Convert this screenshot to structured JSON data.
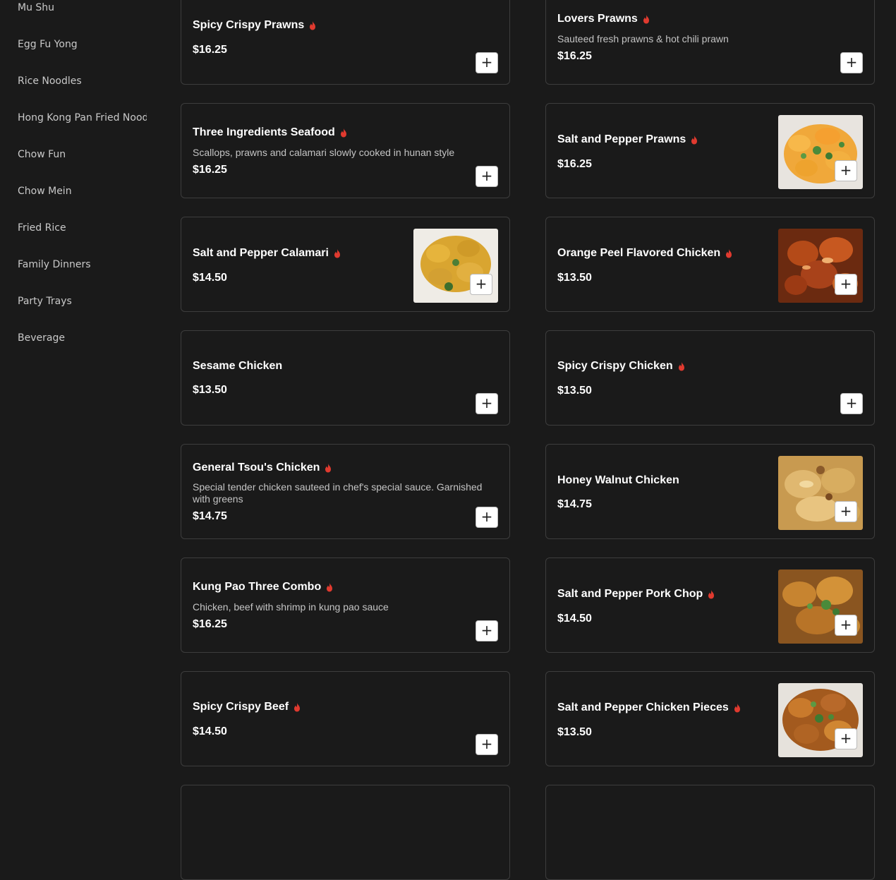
{
  "sidebar": {
    "items": [
      {
        "label": "Mu Shu"
      },
      {
        "label": "Egg Fu Yong"
      },
      {
        "label": "Rice Noodles"
      },
      {
        "label": "Hong Kong Pan Fried Noodles"
      },
      {
        "label": "Chow Fun"
      },
      {
        "label": "Chow Mein"
      },
      {
        "label": "Fried Rice"
      },
      {
        "label": "Family Dinners"
      },
      {
        "label": "Party Trays"
      },
      {
        "label": "Beverage"
      }
    ]
  },
  "menu": {
    "add_label": "+",
    "spicy_icon": "flame-icon",
    "spicy_color": "#e03a2f",
    "items": [
      {
        "name": "Spicy Crispy Prawns",
        "price": "$16.25",
        "spicy": true
      },
      {
        "name": "Lovers Prawns",
        "desc": "Sauteed fresh prawns & hot chili prawn",
        "price": "$16.25",
        "spicy": true
      },
      {
        "name": "Three Ingredients Seafood",
        "desc": "Scallops, prawns and calamari slowly cooked in hunan style",
        "price": "$16.25",
        "spicy": true
      },
      {
        "name": "Salt and Pepper Prawns",
        "price": "$16.25",
        "spicy": true,
        "photo": "prawns-photo"
      },
      {
        "name": "Salt and Pepper Calamari",
        "price": "$14.50",
        "spicy": true,
        "photo": "calamari-photo"
      },
      {
        "name": "Orange Peel Flavored Chicken",
        "price": "$13.50",
        "spicy": true,
        "photo": "orange-chicken-photo"
      },
      {
        "name": "Sesame Chicken",
        "price": "$13.50",
        "spicy": false
      },
      {
        "name": "Spicy Crispy Chicken",
        "price": "$13.50",
        "spicy": true
      },
      {
        "name": "General Tsou's Chicken",
        "desc": "Special tender chicken sauteed in chef's special sauce. Garnished with greens",
        "price": "$14.75",
        "spicy": true
      },
      {
        "name": "Honey Walnut Chicken",
        "price": "$14.75",
        "spicy": false,
        "photo": "honey-walnut-photo"
      },
      {
        "name": "Kung Pao Three Combo",
        "desc": "Chicken, beef with shrimp in kung pao sauce",
        "price": "$16.25",
        "spicy": true
      },
      {
        "name": "Salt and Pepper Pork Chop",
        "price": "$14.50",
        "spicy": true,
        "photo": "pork-chop-photo"
      },
      {
        "name": "Spicy Crispy Beef",
        "price": "$14.50",
        "spicy": true
      },
      {
        "name": "Salt and Pepper Chicken Pieces",
        "price": "$13.50",
        "spicy": true,
        "photo": "chicken-pieces-photo"
      }
    ]
  }
}
